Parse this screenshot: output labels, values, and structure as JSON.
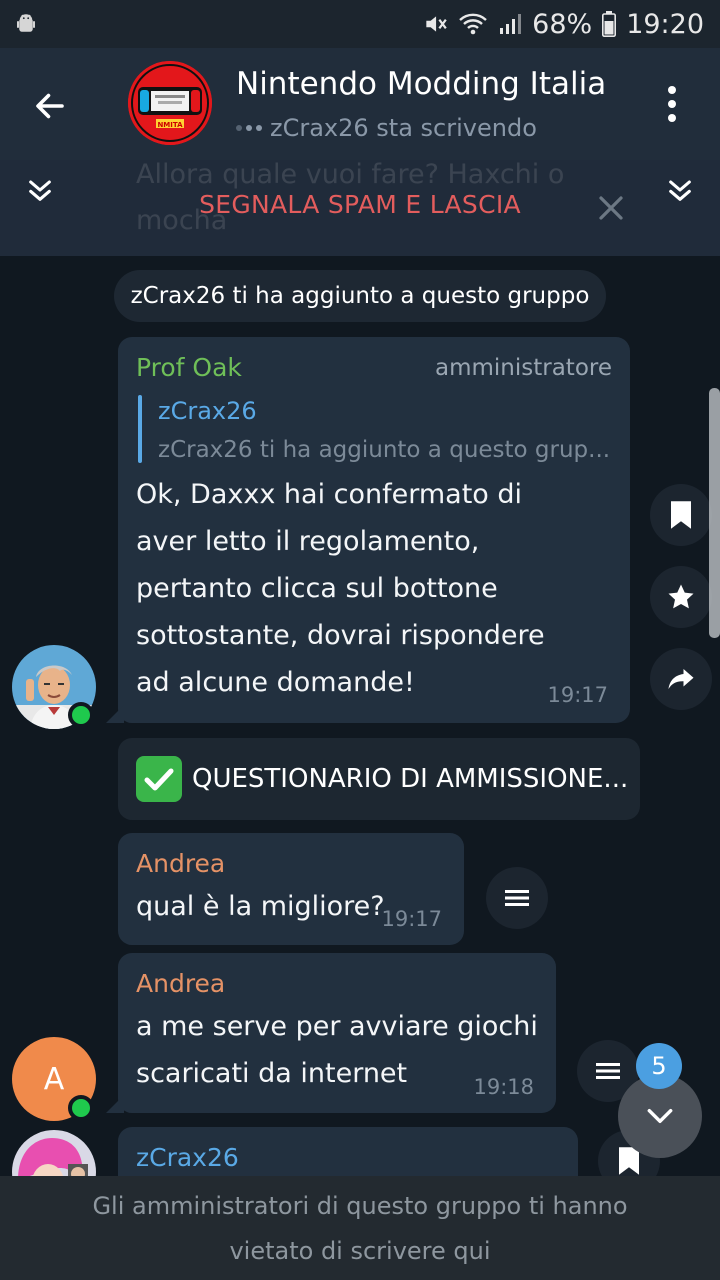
{
  "status_bar": {
    "battery": "68%",
    "time": "19:20",
    "icons": [
      "android-icon",
      "mute-icon",
      "wifi-icon",
      "signal-icon",
      "battery-icon"
    ]
  },
  "header": {
    "title": "Nintendo Modding Italia",
    "subtitle": "zCrax26 sta scrivendo",
    "icons": [
      "back-arrow-icon",
      "group-avatar",
      "more-vertical-icon"
    ]
  },
  "spam_banner": {
    "label": "SEGNALA SPAM E LASCIA",
    "ghost_text": "Allora quale vuoi fare? Haxchi o mocha"
  },
  "messages": {
    "system": "zCrax26 ti ha aggiunto a questo gruppo",
    "m1": {
      "sender": "Prof Oak",
      "badge": "amministratore",
      "reply_name": "zCrax26",
      "reply_text": "zCrax26 ti ha aggiunto a questo grup...",
      "lines": [
        "Ok, Daxxx hai confermato di",
        "aver letto il regolamento,",
        "pertanto clicca sul bottone",
        "sottostante, dovrai rispondere",
        "ad alcune domande!"
      ],
      "time": "19:17"
    },
    "inline_button": "QUESTIONARIO DI AMMISSIONE...",
    "m2": {
      "sender": "Andrea",
      "text": "qual è la migliore?",
      "time": "19:17"
    },
    "m3": {
      "sender": "Andrea",
      "lines": [
        "a me serve per avviare giochi",
        "scaricati da internet"
      ],
      "time": "19:18"
    },
    "m4": {
      "sender": "zCrax26"
    },
    "avatar_letter": "A"
  },
  "unread_badge": "5",
  "bottom_bar": {
    "lines": [
      "Gli amministratori di questo gruppo ti hanno",
      "vietato di scrivere qui"
    ]
  },
  "colors": {
    "background": "#101820",
    "header": "#212d3b",
    "bubble": "#22303f",
    "spam_red": "#e35d5d",
    "prof_oak_green": "#6fbf58",
    "andrea_orange": "#e59266",
    "zcrax_blue": "#5aa9e6",
    "online_green": "#1fc94d",
    "badge_blue": "#4b9fe1"
  }
}
